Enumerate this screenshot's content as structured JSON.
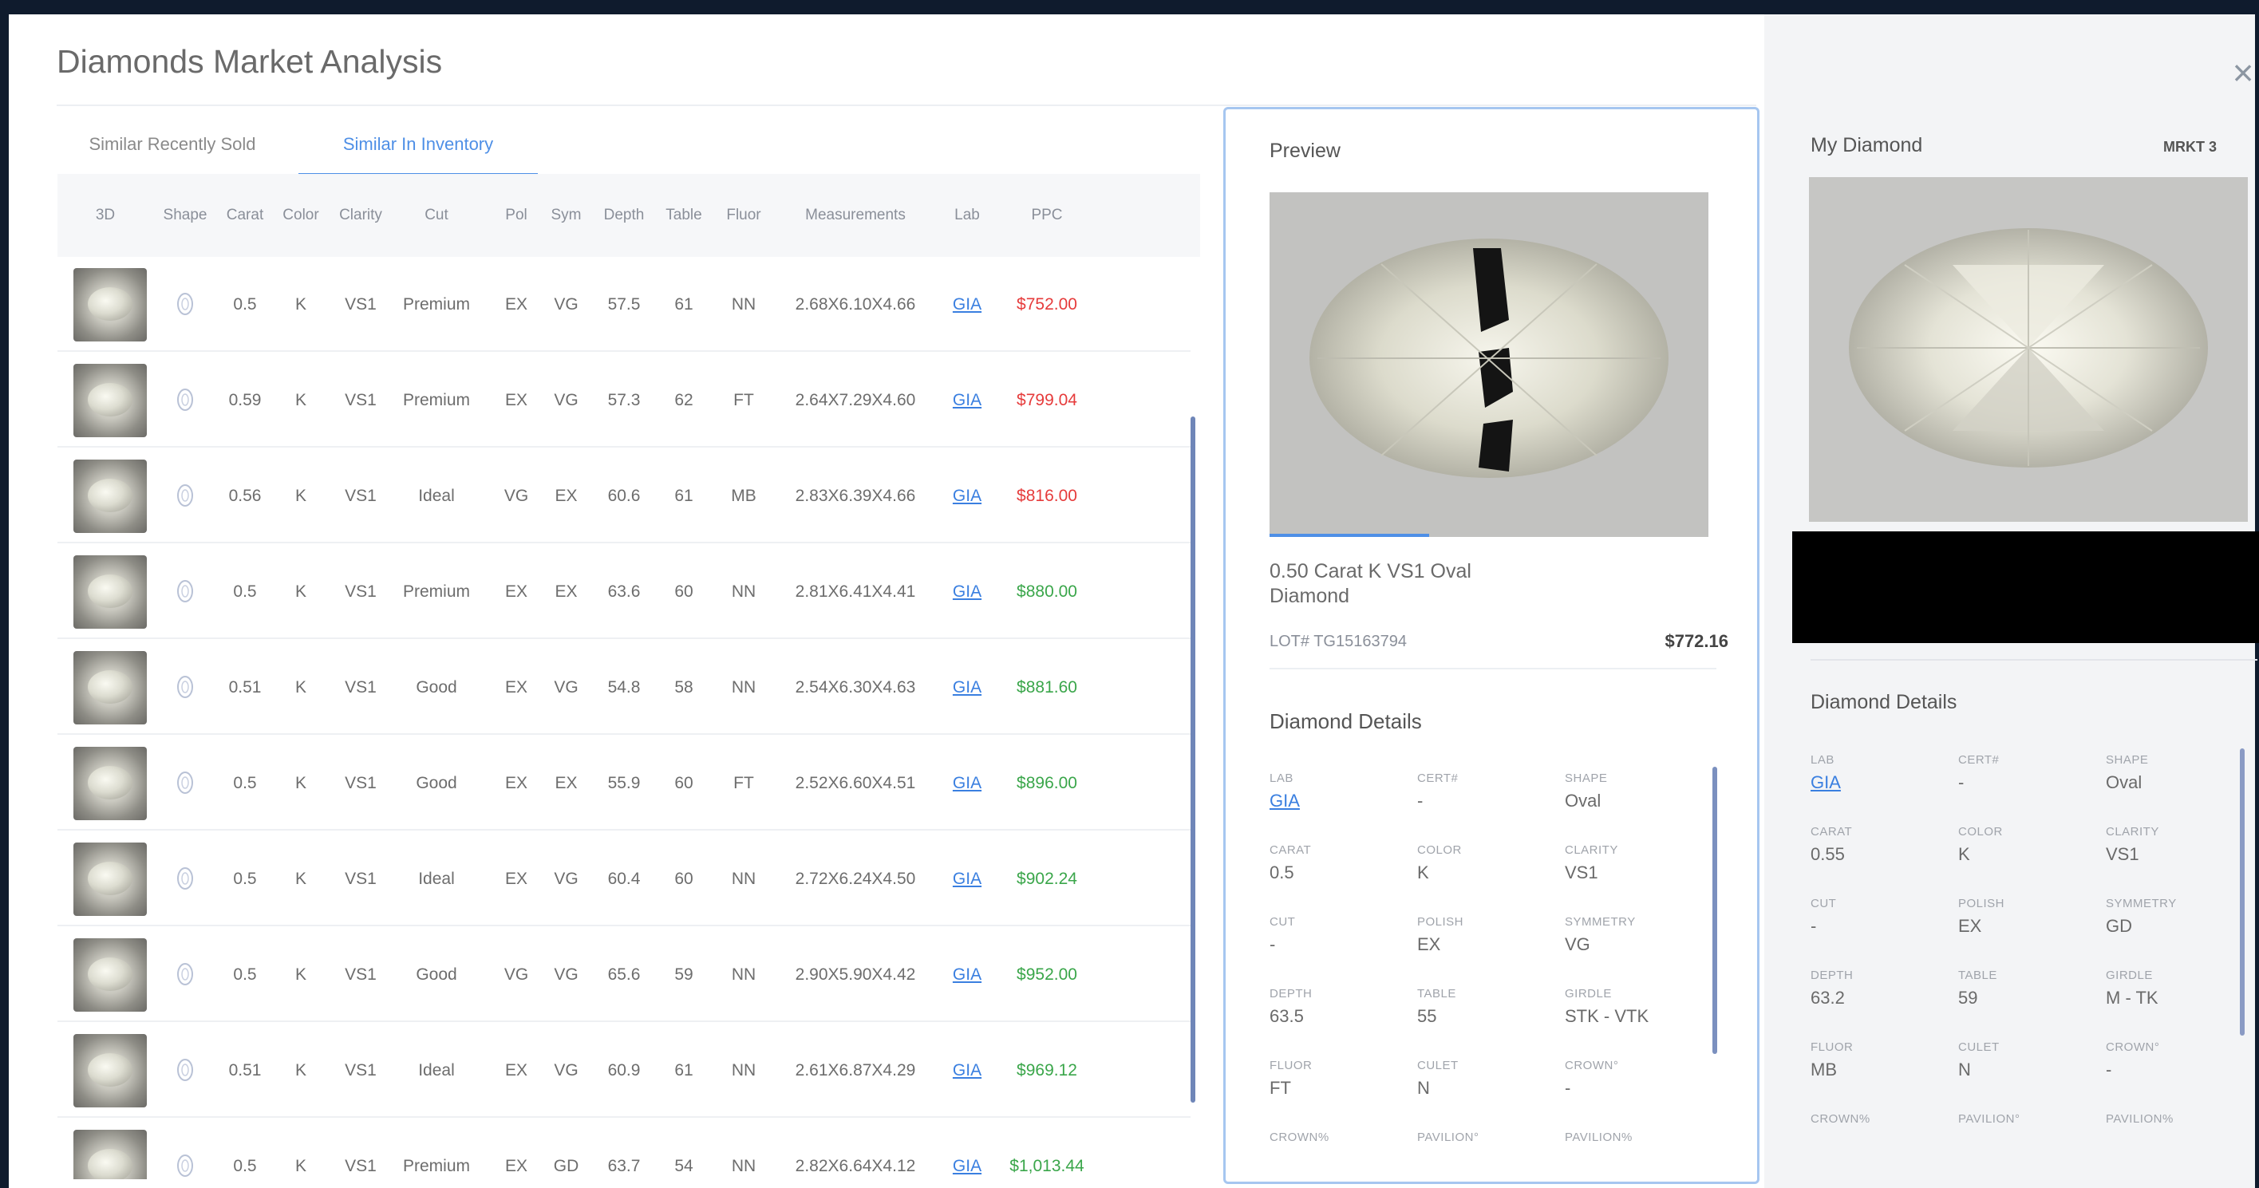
{
  "title": "Diamonds Market Analysis",
  "close_icon": "×",
  "tabs": [
    "Similar Recently Sold",
    "Similar In Inventory"
  ],
  "table": {
    "headers": [
      "3D",
      "Shape",
      "Carat",
      "Color",
      "Clarity",
      "Cut",
      "Pol",
      "Sym",
      "Depth",
      "Table",
      "Fluor",
      "Measurements",
      "Lab",
      "PPC"
    ],
    "rows": [
      {
        "carat": "0.5",
        "color": "K",
        "clarity": "VS1",
        "cut": "Premium",
        "pol": "EX",
        "sym": "VG",
        "depth": "57.5",
        "table": "61",
        "fluor": "NN",
        "meas": "2.68X6.10X4.66",
        "lab": "GIA",
        "ppc": "$752.00",
        "ppc_color": "red"
      },
      {
        "carat": "0.59",
        "color": "K",
        "clarity": "VS1",
        "cut": "Premium",
        "pol": "EX",
        "sym": "VG",
        "depth": "57.3",
        "table": "62",
        "fluor": "FT",
        "meas": "2.64X7.29X4.60",
        "lab": "GIA",
        "ppc": "$799.04",
        "ppc_color": "red"
      },
      {
        "carat": "0.56",
        "color": "K",
        "clarity": "VS1",
        "cut": "Ideal",
        "pol": "VG",
        "sym": "EX",
        "depth": "60.6",
        "table": "61",
        "fluor": "MB",
        "meas": "2.83X6.39X4.66",
        "lab": "GIA",
        "ppc": "$816.00",
        "ppc_color": "red"
      },
      {
        "carat": "0.5",
        "color": "K",
        "clarity": "VS1",
        "cut": "Premium",
        "pol": "EX",
        "sym": "EX",
        "depth": "63.6",
        "table": "60",
        "fluor": "NN",
        "meas": "2.81X6.41X4.41",
        "lab": "GIA",
        "ppc": "$880.00",
        "ppc_color": "green"
      },
      {
        "carat": "0.51",
        "color": "K",
        "clarity": "VS1",
        "cut": "Good",
        "pol": "EX",
        "sym": "VG",
        "depth": "54.8",
        "table": "58",
        "fluor": "NN",
        "meas": "2.54X6.30X4.63",
        "lab": "GIA",
        "ppc": "$881.60",
        "ppc_color": "green"
      },
      {
        "carat": "0.5",
        "color": "K",
        "clarity": "VS1",
        "cut": "Good",
        "pol": "EX",
        "sym": "EX",
        "depth": "55.9",
        "table": "60",
        "fluor": "FT",
        "meas": "2.52X6.60X4.51",
        "lab": "GIA",
        "ppc": "$896.00",
        "ppc_color": "green"
      },
      {
        "carat": "0.5",
        "color": "K",
        "clarity": "VS1",
        "cut": "Ideal",
        "pol": "EX",
        "sym": "VG",
        "depth": "60.4",
        "table": "60",
        "fluor": "NN",
        "meas": "2.72X6.24X4.50",
        "lab": "GIA",
        "ppc": "$902.24",
        "ppc_color": "green"
      },
      {
        "carat": "0.5",
        "color": "K",
        "clarity": "VS1",
        "cut": "Good",
        "pol": "VG",
        "sym": "VG",
        "depth": "65.6",
        "table": "59",
        "fluor": "NN",
        "meas": "2.90X5.90X4.42",
        "lab": "GIA",
        "ppc": "$952.00",
        "ppc_color": "green"
      },
      {
        "carat": "0.51",
        "color": "K",
        "clarity": "VS1",
        "cut": "Ideal",
        "pol": "EX",
        "sym": "VG",
        "depth": "60.9",
        "table": "61",
        "fluor": "NN",
        "meas": "2.61X6.87X4.29",
        "lab": "GIA",
        "ppc": "$969.12",
        "ppc_color": "green"
      },
      {
        "carat": "0.5",
        "color": "K",
        "clarity": "VS1",
        "cut": "Premium",
        "pol": "EX",
        "sym": "GD",
        "depth": "63.7",
        "table": "54",
        "fluor": "NN",
        "meas": "2.82X6.64X4.12",
        "lab": "GIA",
        "ppc": "$1,013.44",
        "ppc_color": "green"
      }
    ]
  },
  "preview": {
    "title": "Preview",
    "name": "0.50 Carat K VS1 Oval Diamond",
    "lot": "LOT# TG15163794",
    "price": "$772.16",
    "details_title": "Diamond Details",
    "details": [
      {
        "label": "LAB",
        "value": "GIA",
        "link": true
      },
      {
        "label": "CERT#",
        "value": "-"
      },
      {
        "label": "SHAPE",
        "value": "Oval"
      },
      {
        "label": "CARAT",
        "value": "0.5"
      },
      {
        "label": "COLOR",
        "value": "K"
      },
      {
        "label": "CLARITY",
        "value": "VS1"
      },
      {
        "label": "CUT",
        "value": "-"
      },
      {
        "label": "POLISH",
        "value": "EX"
      },
      {
        "label": "SYMMETRY",
        "value": "VG"
      },
      {
        "label": "DEPTH",
        "value": "63.5"
      },
      {
        "label": "TABLE",
        "value": "55"
      },
      {
        "label": "GIRDLE",
        "value": "STK - VTK"
      },
      {
        "label": "FLUOR",
        "value": "FT"
      },
      {
        "label": "CULET",
        "value": "N"
      },
      {
        "label": "CROWN°",
        "value": "-"
      },
      {
        "label": "CROWN%",
        "value": ""
      },
      {
        "label": "PAVILION°",
        "value": ""
      },
      {
        "label": "PAVILION%",
        "value": ""
      }
    ]
  },
  "my_diamond": {
    "title": "My Diamond",
    "mkt": "MRKT 3",
    "details_title": "Diamond Details",
    "details": [
      {
        "label": "LAB",
        "value": "GIA",
        "link": true
      },
      {
        "label": "CERT#",
        "value": "-"
      },
      {
        "label": "SHAPE",
        "value": "Oval"
      },
      {
        "label": "CARAT",
        "value": "0.55"
      },
      {
        "label": "COLOR",
        "value": "K"
      },
      {
        "label": "CLARITY",
        "value": "VS1"
      },
      {
        "label": "CUT",
        "value": "-"
      },
      {
        "label": "POLISH",
        "value": "EX"
      },
      {
        "label": "SYMMETRY",
        "value": "GD"
      },
      {
        "label": "DEPTH",
        "value": "63.2"
      },
      {
        "label": "TABLE",
        "value": "59"
      },
      {
        "label": "GIRDLE",
        "value": "M - TK"
      },
      {
        "label": "FLUOR",
        "value": "MB"
      },
      {
        "label": "CULET",
        "value": "N"
      },
      {
        "label": "CROWN°",
        "value": "-"
      },
      {
        "label": "CROWN%",
        "value": ""
      },
      {
        "label": "PAVILION°",
        "value": ""
      },
      {
        "label": "PAVILION%",
        "value": ""
      }
    ]
  },
  "colors": {
    "accent": "#4e8fe6",
    "price_red": "#e63b3b",
    "price_green": "#3aa64a",
    "link": "#3a7fe0"
  }
}
